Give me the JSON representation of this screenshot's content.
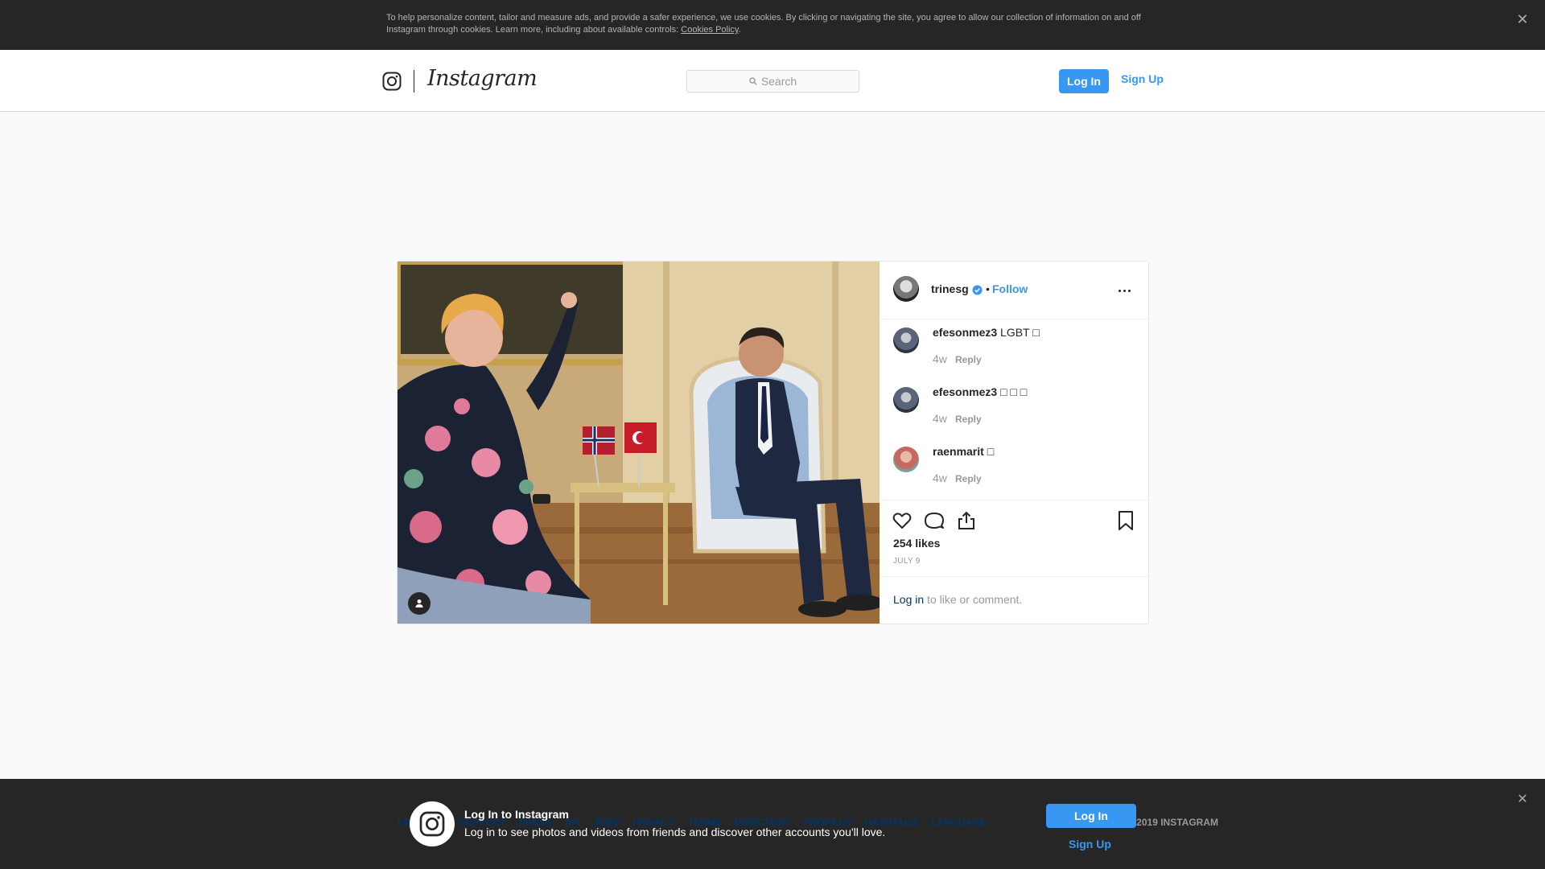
{
  "cookie_banner": {
    "text": "To help personalize content, tailor and measure ads, and provide a safer experience, we use cookies. By clicking or navigating the site, you agree to allow our collection of information on and off Instagram through cookies. Learn more, including about available controls: ",
    "link": "Cookies Policy",
    "trailing": ".",
    "close_icon": "close-icon"
  },
  "nav": {
    "wordmark": "Instagram",
    "search_placeholder": "Search",
    "login_label": "Log In",
    "signup_label": "Sign Up"
  },
  "post": {
    "username": "trinesg",
    "separator": "•",
    "follow_label": "Follow",
    "comments": [
      {
        "user": "efesonmez3",
        "text": " LGBT □",
        "time": "4w",
        "reply": "Reply"
      },
      {
        "user": "efesonmez3",
        "text": " □ □ □",
        "time": "4w",
        "reply": "Reply"
      },
      {
        "user": "raenmarit",
        "text": " □",
        "time": "4w",
        "reply": "Reply"
      }
    ],
    "likes": "254 likes",
    "date": "JULY 9",
    "login_link": "Log in",
    "login_suffix": " to like or comment."
  },
  "footer": {
    "links": [
      "ABOUT US",
      "SUPPORT",
      "PRESS",
      "API",
      "JOBS",
      "PRIVACY",
      "TERMS",
      "DIRECTORY",
      "PROFILES",
      "HASHTAGS",
      "LANGUAGE"
    ],
    "copyright": "© 2019 INSTAGRAM"
  },
  "login_prompt": {
    "title": "Log In to Instagram",
    "subtitle": "Log in to see photos and videos from friends and discover other accounts you'll love.",
    "login_label": "Log In",
    "signup_label": "Sign Up"
  },
  "colors": {
    "accent": "#3897f0",
    "dark": "#262626",
    "link_dark": "#003569"
  }
}
